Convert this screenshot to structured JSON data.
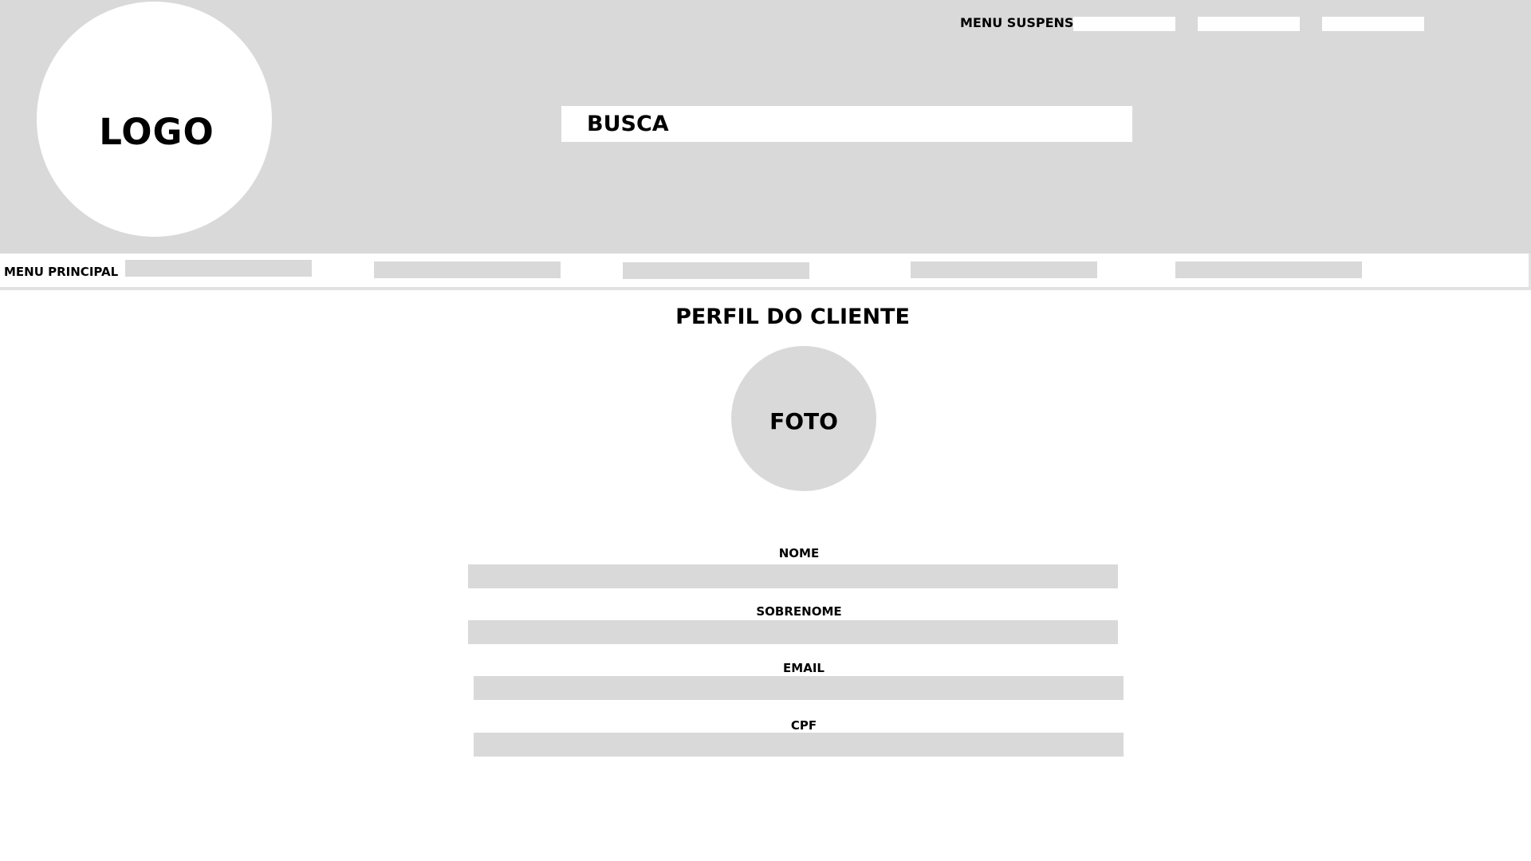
{
  "header": {
    "logo_text": "LOGO",
    "dropdown_menu": {
      "label": "MENU SUSPENSO",
      "item_count": 3
    },
    "search": {
      "label": "BUSCA"
    }
  },
  "main_menu": {
    "label": "MENU PRINCIPAL",
    "item_count": 5
  },
  "profile": {
    "title": "PERFIL DO CLIENTE",
    "photo_label": "FOTO",
    "fields": {
      "nome": {
        "label": "NOME",
        "value": ""
      },
      "sobrenome": {
        "label": "SOBRENOME",
        "value": ""
      },
      "email": {
        "label": "EMAIL",
        "value": ""
      },
      "cpf": {
        "label": "CPF",
        "value": ""
      }
    }
  },
  "colors": {
    "placeholder_gray": "#d9d9d9",
    "background": "#ffffff",
    "text": "#000000"
  }
}
